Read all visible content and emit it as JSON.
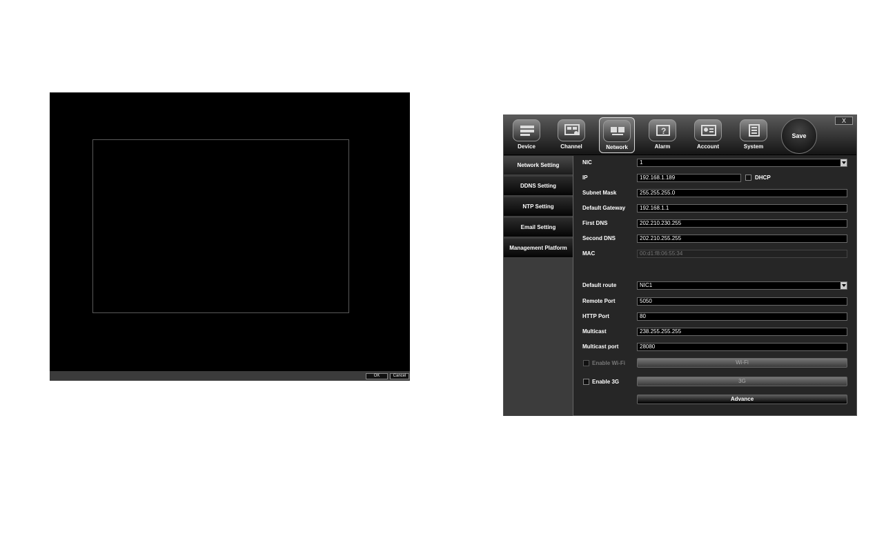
{
  "preview": {
    "ok_label": "OK",
    "cancel_label": "Cancel"
  },
  "toolbar": {
    "items": [
      {
        "label": "Device",
        "icon": "device-icon"
      },
      {
        "label": "Channel",
        "icon": "channel-icon"
      },
      {
        "label": "Network",
        "icon": "network-icon",
        "active": true
      },
      {
        "label": "Alarm",
        "icon": "alarm-icon"
      },
      {
        "label": "Account",
        "icon": "account-icon"
      },
      {
        "label": "System",
        "icon": "system-icon"
      }
    ],
    "save_label": "Save",
    "close_label": "X"
  },
  "sidebar": {
    "items": [
      {
        "label": "Network Setting",
        "active": true
      },
      {
        "label": "DDNS Setting"
      },
      {
        "label": "NTP Setting"
      },
      {
        "label": "Email Setting"
      },
      {
        "label": "Management Platform"
      }
    ]
  },
  "form": {
    "nic": {
      "label": "NIC",
      "value": "1"
    },
    "ip": {
      "label": "IP",
      "value": "192.168.1.189"
    },
    "dhcp": {
      "label": "DHCP",
      "checked": false
    },
    "subnet_mask": {
      "label": "Subnet Mask",
      "value": "255.255.255.0"
    },
    "default_gateway": {
      "label": "Default Gateway",
      "value": "192.168.1.1"
    },
    "first_dns": {
      "label": "First DNS",
      "value": "202.210.230.255"
    },
    "second_dns": {
      "label": "Second DNS",
      "value": "202.210.255.255"
    },
    "mac": {
      "label": "MAC",
      "value": "00:d1:f8:06:55:34"
    },
    "default_route": {
      "label": "Default route",
      "value": "NIC1"
    },
    "remote_port": {
      "label": "Remote Port",
      "value": "5050"
    },
    "http_port": {
      "label": "HTTP Port",
      "value": "80"
    },
    "multicast": {
      "label": "Multicast",
      "value": "238.255.255.255"
    },
    "multicast_port": {
      "label": "Multicast port",
      "value": "28080"
    },
    "enable_wifi": {
      "label": "Enable Wi-Fi",
      "button": "Wi-Fi"
    },
    "enable_3g": {
      "label": "Enable 3G",
      "button": "3G"
    },
    "advance_label": "Advance"
  },
  "colors": {
    "panel_bg": "#262626",
    "sidebar_bg": "#3c3c3c",
    "field_bg": "#000000",
    "text": "#ffffff"
  }
}
